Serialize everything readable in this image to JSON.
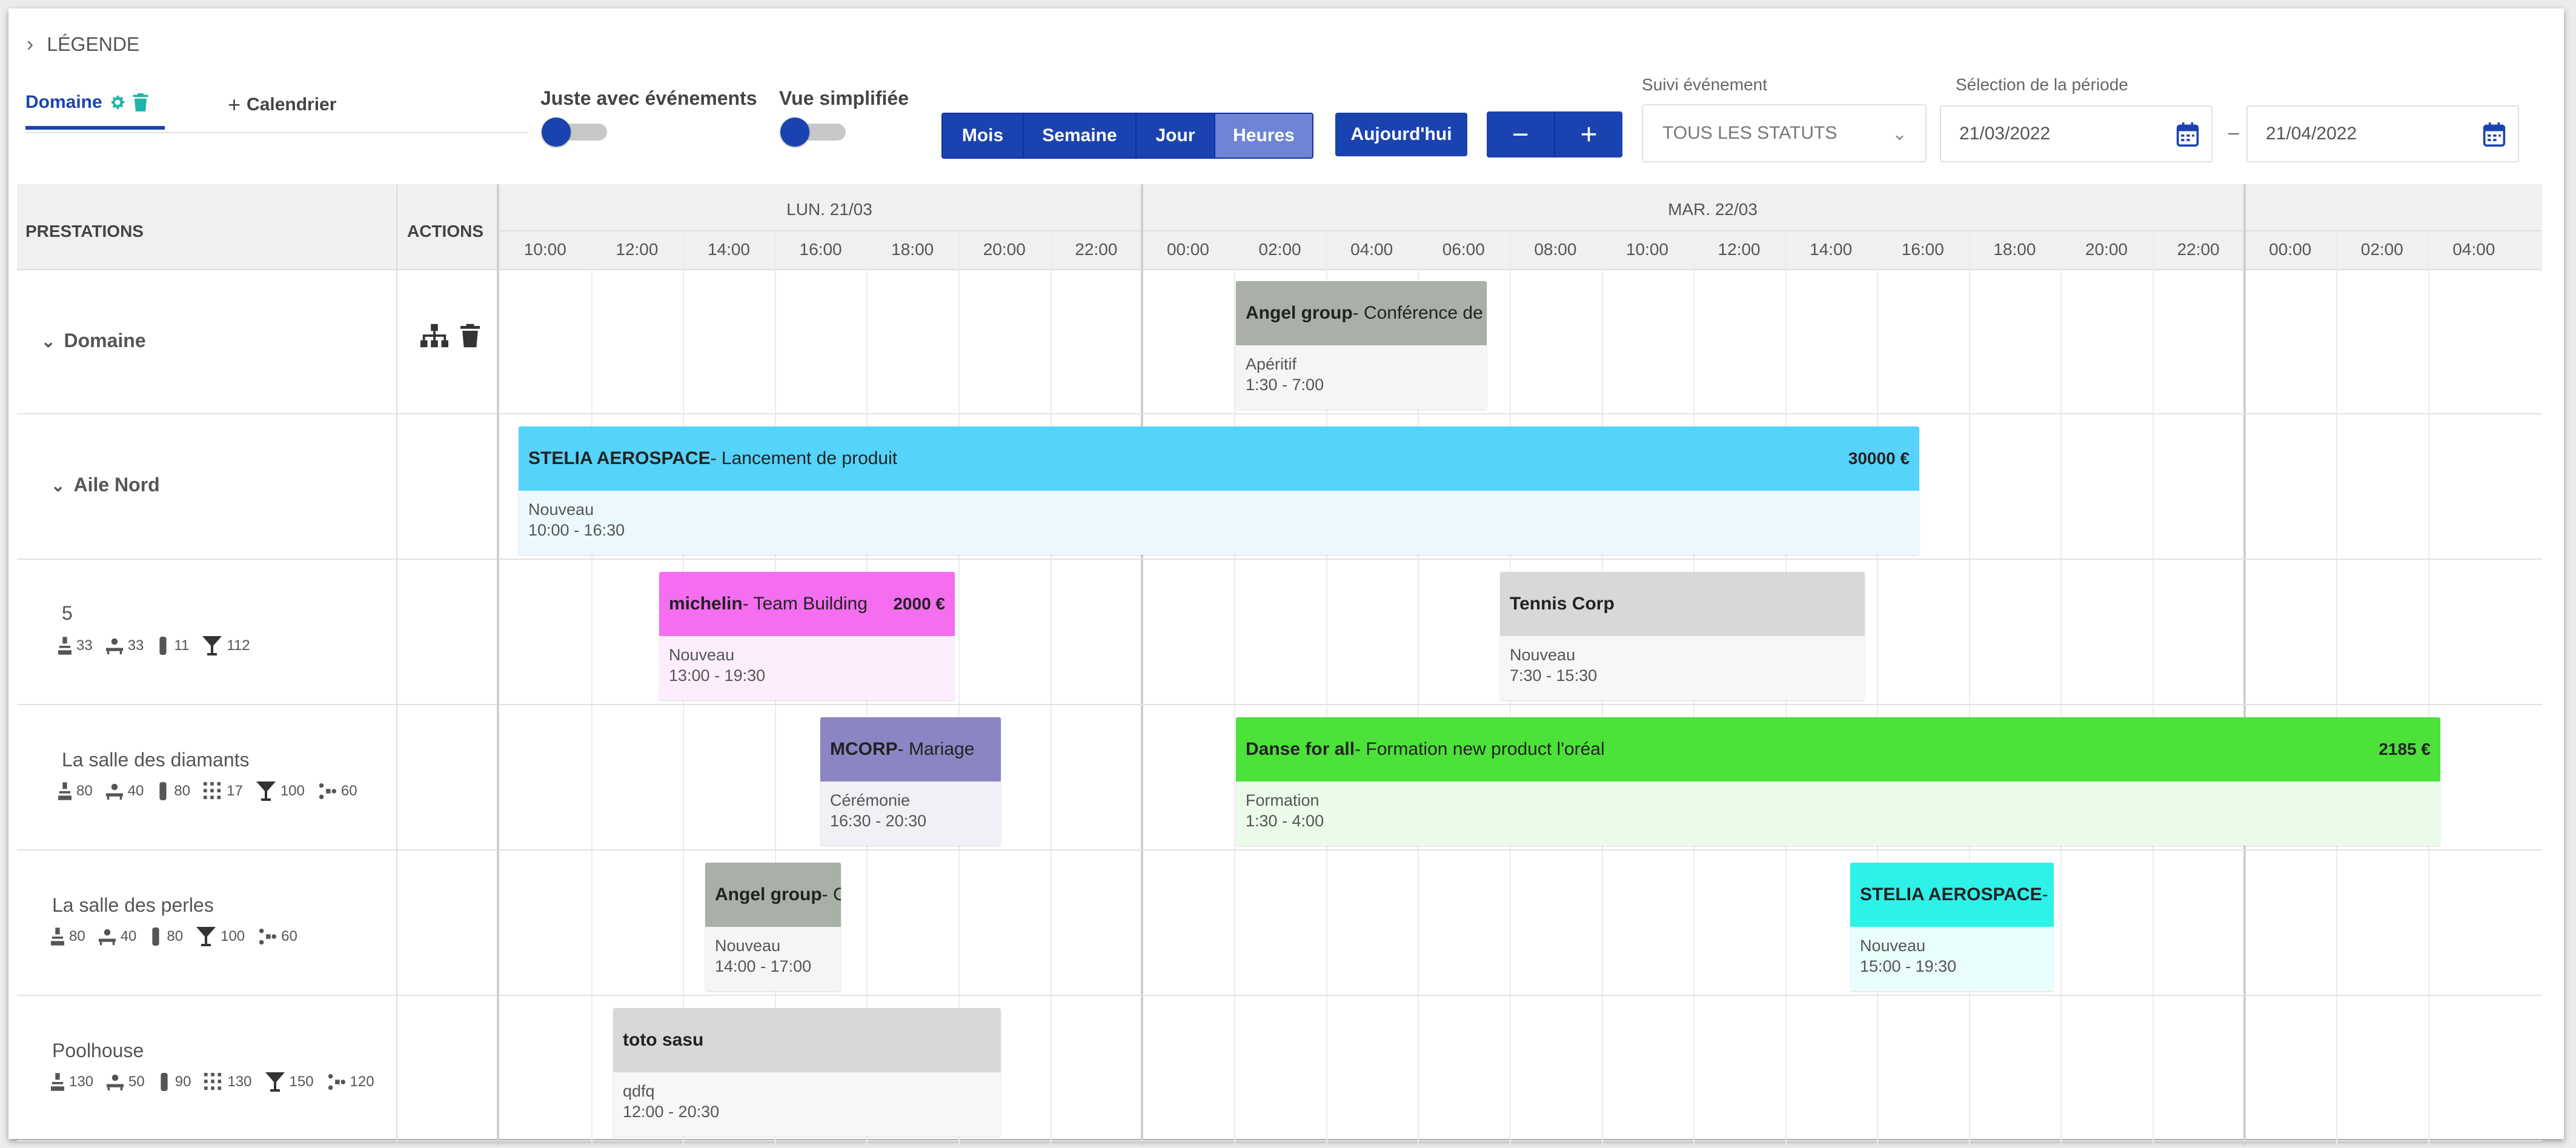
{
  "legend": {
    "label": "LÉGENDE"
  },
  "tabs": {
    "domaine": "Domaine",
    "calendrier": "Calendrier"
  },
  "toggles": {
    "juste_evenements": "Juste avec événements",
    "vue_simplifiee": "Vue simplifiée"
  },
  "view_buttons": [
    "Mois",
    "Semaine",
    "Jour",
    "Heures"
  ],
  "today_button": "Aujourd'hui",
  "zoom": {
    "minus": "−",
    "plus": "+"
  },
  "suivi": {
    "label": "Suivi événement",
    "value": "TOUS LES STATUTS"
  },
  "periode": {
    "label": "Sélection de la période",
    "from": "21/03/2022",
    "to": "21/04/2022"
  },
  "columns": {
    "prestations": "PRESTATIONS",
    "actions": "ACTIONS"
  },
  "days": [
    "LUN. 21/03",
    "MAR. 22/03"
  ],
  "hours": [
    "10:00",
    "12:00",
    "14:00",
    "16:00",
    "18:00",
    "20:00",
    "22:00",
    "00:00",
    "02:00",
    "04:00",
    "06:00",
    "08:00",
    "10:00",
    "12:00",
    "14:00",
    "16:00",
    "18:00",
    "20:00",
    "22:00",
    "00:00",
    "02:00",
    "04:00"
  ],
  "rows": [
    {
      "name": "Domaine"
    },
    {
      "name": "Aile Nord"
    },
    {
      "name": "5",
      "caps": [
        "33",
        "33",
        "11",
        "112"
      ]
    },
    {
      "name": "La salle des diamants",
      "caps": [
        "80",
        "40",
        "80",
        "17",
        "100",
        "60"
      ]
    },
    {
      "name": "La salle des perles",
      "caps": [
        "80",
        "40",
        "80",
        "100",
        "60"
      ]
    },
    {
      "name": "Poolhouse",
      "caps": [
        "130",
        "50",
        "90",
        "130",
        "150",
        "120"
      ]
    }
  ],
  "events": [
    {
      "client": "Angel group",
      "title": " - Conférence de",
      "status": "Apéritif",
      "time": "1:30 - 7:00",
      "head_color": "#a8b0a8",
      "body_color": "#f5f5f5"
    },
    {
      "client": "STELIA AEROSPACE",
      "title": " - Lancement de produit",
      "price": "30000 €",
      "status": "Nouveau",
      "time": "10:00 - 16:30",
      "head_color": "#56d3fa",
      "body_color": "#ebf9fe"
    },
    {
      "client": "michelin",
      "title": " - Team Building",
      "price": "2000 €",
      "status": "Nouveau",
      "time": "13:00 - 19:30",
      "head_color": "#f56ef0",
      "body_color": "#feeefd"
    },
    {
      "client": "Tennis Corp",
      "title": "",
      "status": "Nouveau",
      "time": "7:30 - 15:30",
      "head_color": "#d8d8d8",
      "body_color": "#f7f7f7"
    },
    {
      "client": "MCORP",
      "title": " - Mariage",
      "status": "Cérémonie",
      "time": "16:30 - 20:30",
      "head_color": "#8b85c3",
      "body_color": "#f1f0f7"
    },
    {
      "client": "Danse for all",
      "title": " - Formation new product l'oréal",
      "price": "2185 €",
      "status": "Formation",
      "time": "1:30 - 4:00",
      "head_color": "#4ce23a",
      "body_color": "#ebfbe9"
    },
    {
      "client": "Angel group",
      "title": " - C",
      "status": "Nouveau",
      "time": "14:00 - 17:00",
      "head_color": "#a8b0a8",
      "body_color": "#f5f5f5"
    },
    {
      "client": "STELIA AEROSPACE",
      "title": " - C",
      "status": "Nouveau",
      "time": "15:00 - 19:30",
      "head_color": "#2ef2e8",
      "body_color": "#e9fdfc"
    },
    {
      "client": "toto sasu",
      "title": "",
      "status": "qdfq",
      "time": "12:00 - 20:30",
      "head_color": "#d8d8d8",
      "body_color": "#f7f7f7"
    }
  ],
  "colors": {
    "primary": "#1b43b0",
    "primary_light": "#6f84d6"
  }
}
